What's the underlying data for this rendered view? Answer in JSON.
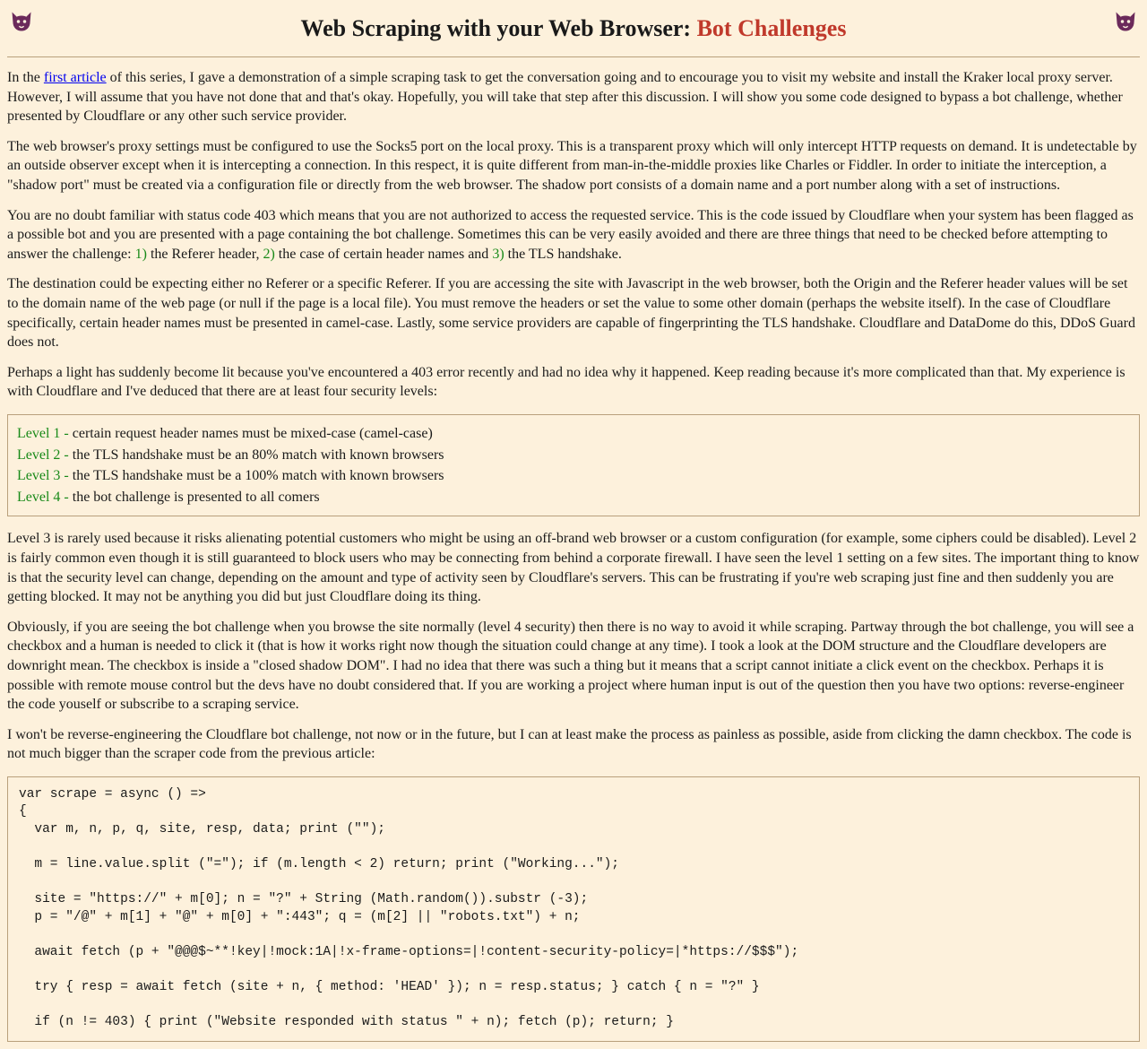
{
  "header": {
    "title_plain": "Web Scraping with your Web Browser: ",
    "title_emph": "Bot Challenges",
    "icon_name": "cat-icon"
  },
  "p1": {
    "lead": "In the ",
    "link_text": "first article",
    "rest": " of this series, I gave a demonstration of a simple scraping task to get the conversation going and to encourage you to visit my website and install the Kraker local proxy server. However, I will assume that you have not done that and that's okay. Hopefully, you will take that step after this discussion. I will show you some code designed to bypass a bot challenge, whether presented by Cloudflare or any other such service provider."
  },
  "p2": "The web browser's proxy settings must be configured to use the Socks5 port on the local proxy. This is a transparent proxy which will only intercept HTTP requests on demand. It is undetectable by an outside observer except when it is intercepting a connection. In this respect, it is quite different from man-in-the-middle proxies like Charles or Fiddler. In order to initiate the interception, a \"shadow port\" must be created via a configuration file or directly from the web browser. The shadow port consists of a domain name and a port number along with a set of instructions.",
  "p3": {
    "a": "You are no doubt familiar with status code 403 which means that you are not authorized to access the requested service. This is the code issued by Cloudflare when your system has been flagged as a possible bot and you are presented with a page containing the bot challenge. Sometimes this can be very easily avoided and there are three things that need to be checked before attempting to answer the challenge: ",
    "n1": "1)",
    "b": " the Referer header, ",
    "n2": "2)",
    "c": " the case of certain header names and ",
    "n3": "3)",
    "d": " the TLS handshake."
  },
  "p4": "The destination could be expecting either no Referer or a specific Referer. If you are accessing the site with Javascript in the web browser, both the Origin and the Referer header values will be set to the domain name of the web page (or null if the page is a local file). You must remove the headers or set the value to some other domain (perhaps the website itself). In the case of Cloudflare specifically, certain header names must be presented in camel-case. Lastly, some service providers are capable of fingerprinting the TLS handshake. Cloudflare and DataDome do this, DDoS Guard does not.",
  "p5": "Perhaps a light has suddenly become lit because you've encountered a 403 error recently and had no idea why it happened. Keep reading because it's more complicated than that. My experience is with Cloudflare and I've deduced that there are at least four security levels:",
  "levels": [
    {
      "label": "Level 1 - ",
      "text": "certain request header names must be mixed-case (camel-case)"
    },
    {
      "label": "Level 2 - ",
      "text": "the TLS handshake must be an 80% match with known browsers"
    },
    {
      "label": "Level 3 - ",
      "text": "the TLS handshake must be a 100% match with known browsers"
    },
    {
      "label": "Level 4 - ",
      "text": "the bot challenge is presented to all comers"
    }
  ],
  "p6": "Level 3 is rarely used because it risks alienating potential customers who might be using an off-brand web browser or a custom configuration (for example, some ciphers could be disabled). Level 2 is fairly common even though it is still guaranteed to block users who may be connecting from behind a corporate firewall. I have seen the level 1 setting on a few sites. The important thing to know is that the security level can change, depending on the amount and type of activity seen by Cloudflare's servers. This can be frustrating if you're web scraping just fine and then suddenly you are getting blocked. It may not be anything you did but just Cloudflare doing its thing.",
  "p7": "Obviously, if you are seeing the bot challenge when you browse the site normally (level 4 security) then there is no way to avoid it while scraping. Partway through the bot challenge, you will see a checkbox and a human is needed to click it (that is how it works right now though the situation could change at any time). I took a look at the DOM structure and the Cloudflare developers are downright mean. The checkbox is inside a \"closed shadow DOM\". I had no idea that there was such a thing but it means that a script cannot initiate a click event on the checkbox. Perhaps it is possible with remote mouse control but the devs have no doubt considered that. If you are working a project where human input is out of the question then you have two options: reverse-engineer the code youself or subscribe to a scraping service.",
  "p8": "I won't be reverse-engineering the Cloudflare bot challenge, not now or in the future, but I can at least make the process as painless as possible, aside from clicking the damn checkbox. The code is not much bigger than the scraper code from the previous article:",
  "code": "var scrape = async () =>\n{\n  var m, n, p, q, site, resp, data; print (\"\");\n\n  m = line.value.split (\"=\"); if (m.length < 2) return; print (\"Working...\");\n\n  site = \"https://\" + m[0]; n = \"?\" + String (Math.random()).substr (-3);\n  p = \"/@\" + m[1] + \"@\" + m[0] + \":443\"; q = (m[2] || \"robots.txt\") + n;\n\n  await fetch (p + \"@@@$~**!key|!mock:1A|!x-frame-options=|!content-security-policy=|*https://$$$\");\n\n  try { resp = await fetch (site + n, { method: 'HEAD' }); n = resp.status; } catch { n = \"?\" }\n\n  if (n != 403) { print (\"Website responded with status \" + n); fetch (p); return; }"
}
